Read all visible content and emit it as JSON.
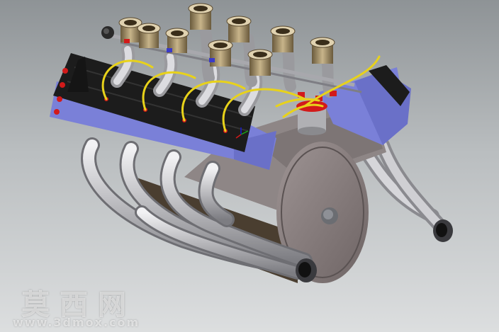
{
  "watermark": {
    "name_cn": "莫西网",
    "url": "www.3dmox.com"
  },
  "colors": {
    "background_top": "#8e9396",
    "background_bottom": "#dcdedf",
    "cam_cover": "#1c1c1c",
    "head_blue": "#7a80d8",
    "block_gray": "#8e8686",
    "pipe_silver": "#c9c9cc",
    "spark_wire": "#e8d21a",
    "accent_red": "#d21a1a",
    "intake_brass": "#8c7a5a"
  }
}
